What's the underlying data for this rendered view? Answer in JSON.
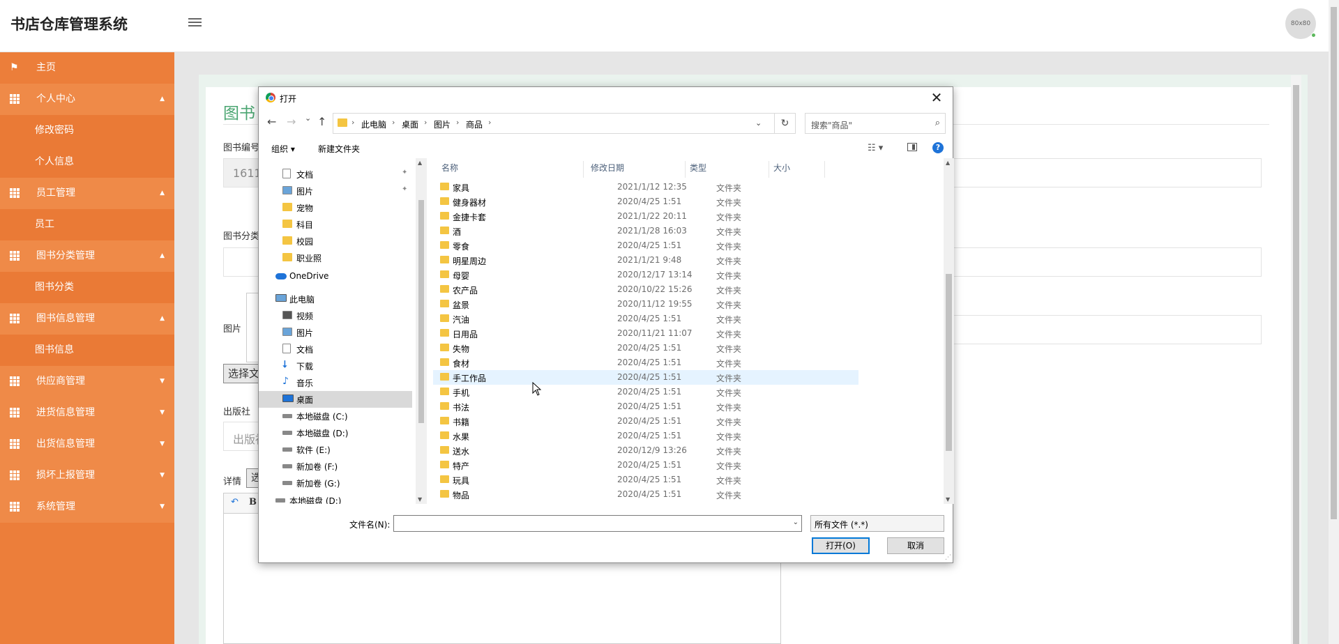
{
  "app": {
    "title": "书店仓库管理系统",
    "avatar_text": "80x80"
  },
  "sidebar": {
    "items": [
      {
        "label": "主页",
        "type": "home"
      },
      {
        "label": "个人中心",
        "type": "head",
        "arrow": "▲"
      },
      {
        "label": "修改密码",
        "type": "sub"
      },
      {
        "label": "个人信息",
        "type": "sub"
      },
      {
        "label": "员工管理",
        "type": "head",
        "arrow": "▲"
      },
      {
        "label": "员工",
        "type": "sub"
      },
      {
        "label": "图书分类管理",
        "type": "head",
        "arrow": "▲"
      },
      {
        "label": "图书分类",
        "type": "sub"
      },
      {
        "label": "图书信息管理",
        "type": "head",
        "arrow": "▲"
      },
      {
        "label": "图书信息",
        "type": "sub"
      },
      {
        "label": "供应商管理",
        "type": "head",
        "arrow": "▼"
      },
      {
        "label": "进货信息管理",
        "type": "head",
        "arrow": "▼"
      },
      {
        "label": "出货信息管理",
        "type": "head",
        "arrow": "▼"
      },
      {
        "label": "损坏上报管理",
        "type": "head",
        "arrow": "▼"
      },
      {
        "label": "系统管理",
        "type": "head",
        "arrow": "▼"
      }
    ]
  },
  "form": {
    "title": "图书",
    "book_no_label": "图书编号",
    "book_no_value": "1611",
    "category_label": "图书分类",
    "image_label": "图片",
    "choose_file_label": "选择文",
    "publisher_label": "出版社",
    "publisher_placeholder": "出版社",
    "detail_label": "详情",
    "detail_btn": "选",
    "editor_bold": "B"
  },
  "dialog": {
    "title": "打开",
    "close_icon": "✕",
    "nav": {
      "back": "←",
      "forward": "→",
      "recent": "⌄",
      "up": "↑"
    },
    "breadcrumbs": [
      "此电脑",
      "桌面",
      "图片",
      "商品"
    ],
    "crumb_sep": "›",
    "refresh": "↻",
    "search_placeholder": "搜索\"商品\"",
    "search_icon": "⌕",
    "toolbar": {
      "organize": "组织 ▾",
      "new_folder": "新建文件夹",
      "view": "☷ ▾",
      "help": "?"
    },
    "nav_pane": [
      {
        "label": "文档",
        "icon": "doc",
        "indent": 1,
        "pinned": true
      },
      {
        "label": "图片",
        "icon": "pic",
        "indent": 1,
        "pinned": true
      },
      {
        "label": "宠物",
        "icon": "folder",
        "indent": 1
      },
      {
        "label": "科目",
        "icon": "folder",
        "indent": 1
      },
      {
        "label": "校园",
        "icon": "folder",
        "indent": 1
      },
      {
        "label": "职业照",
        "icon": "folder",
        "indent": 1
      },
      {
        "label": "OneDrive",
        "icon": "cloud",
        "indent": 0
      },
      {
        "label": "此电脑",
        "icon": "pc",
        "indent": 0
      },
      {
        "label": "视频",
        "icon": "video",
        "indent": 1
      },
      {
        "label": "图片",
        "icon": "pic",
        "indent": 1
      },
      {
        "label": "文档",
        "icon": "doc",
        "indent": 1
      },
      {
        "label": "下载",
        "icon": "down",
        "indent": 1
      },
      {
        "label": "音乐",
        "icon": "music",
        "indent": 1
      },
      {
        "label": "桌面",
        "icon": "desk",
        "indent": 1,
        "selected": true
      },
      {
        "label": "本地磁盘 (C:)",
        "icon": "sysdrive",
        "indent": 1
      },
      {
        "label": "本地磁盘 (D:)",
        "icon": "drive",
        "indent": 1
      },
      {
        "label": "软件 (E:)",
        "icon": "drive",
        "indent": 1
      },
      {
        "label": "新加卷 (F:)",
        "icon": "drive",
        "indent": 1
      },
      {
        "label": "新加卷 (G:)",
        "icon": "drive",
        "indent": 1
      },
      {
        "label": "本地磁盘 (D:)",
        "icon": "drive",
        "indent": 0
      }
    ],
    "columns": {
      "name": "名称",
      "modified": "修改日期",
      "type": "类型",
      "size": "大小"
    },
    "files": [
      {
        "name": "家具",
        "date": "2021/1/12 12:35",
        "type": "文件夹"
      },
      {
        "name": "健身器材",
        "date": "2020/4/25 1:51",
        "type": "文件夹"
      },
      {
        "name": "金捷卡套",
        "date": "2021/1/22 20:11",
        "type": "文件夹"
      },
      {
        "name": "酒",
        "date": "2021/1/28 16:03",
        "type": "文件夹"
      },
      {
        "name": "零食",
        "date": "2020/4/25 1:51",
        "type": "文件夹"
      },
      {
        "name": "明星周边",
        "date": "2021/1/21 9:48",
        "type": "文件夹"
      },
      {
        "name": "母婴",
        "date": "2020/12/17 13:14",
        "type": "文件夹"
      },
      {
        "name": "农产品",
        "date": "2020/10/22 15:26",
        "type": "文件夹"
      },
      {
        "name": "盆景",
        "date": "2020/11/12 19:55",
        "type": "文件夹"
      },
      {
        "name": "汽油",
        "date": "2020/4/25 1:51",
        "type": "文件夹"
      },
      {
        "name": "日用品",
        "date": "2020/11/21 11:07",
        "type": "文件夹"
      },
      {
        "name": "失物",
        "date": "2020/4/25 1:51",
        "type": "文件夹"
      },
      {
        "name": "食材",
        "date": "2020/4/25 1:51",
        "type": "文件夹"
      },
      {
        "name": "手工作品",
        "date": "2020/4/25 1:51",
        "type": "文件夹",
        "hover": true
      },
      {
        "name": "手机",
        "date": "2020/4/25 1:51",
        "type": "文件夹"
      },
      {
        "name": "书法",
        "date": "2020/4/25 1:51",
        "type": "文件夹"
      },
      {
        "name": "书籍",
        "date": "2020/4/25 1:51",
        "type": "文件夹"
      },
      {
        "name": "水果",
        "date": "2020/4/25 1:51",
        "type": "文件夹"
      },
      {
        "name": "送水",
        "date": "2020/12/9 13:26",
        "type": "文件夹"
      },
      {
        "name": "特产",
        "date": "2020/4/25 1:51",
        "type": "文件夹"
      },
      {
        "name": "玩具",
        "date": "2020/4/25 1:51",
        "type": "文件夹"
      },
      {
        "name": "物品",
        "date": "2020/4/25 1:51",
        "type": "文件夹"
      }
    ],
    "filename_label": "文件名(N):",
    "filename_value": "",
    "filetype_value": "所有文件 (*.*)",
    "open_button": "打开(O)",
    "cancel_button": "取消"
  },
  "colors": {
    "sidebar": "#ec7e3a",
    "accent_green": "#4aa571",
    "dialog_selection": "#e5f3ff",
    "primary_border": "#0078d7"
  }
}
